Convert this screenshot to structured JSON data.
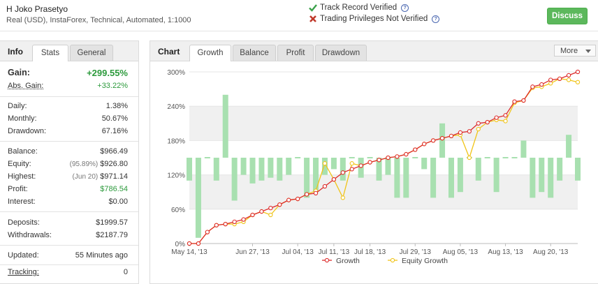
{
  "header": {
    "account_name": "H Joko Prasetyo",
    "account_details": "Real (USD), InstaForex, Technical, Automated, 1:1000",
    "track_record": "Track Record Verified",
    "trading_privileges": "Trading Privileges Not Verified",
    "discuss_label": "Discuss",
    "help_glyph": "?"
  },
  "info": {
    "title": "Info",
    "tabs": [
      {
        "label": "Stats",
        "active": true
      },
      {
        "label": "General",
        "active": false
      }
    ],
    "gain_label": "Gain:",
    "gain_value": "+299.55%",
    "abs_gain_label": "Abs. Gain:",
    "abs_gain_value": "+33.22%",
    "daily_label": "Daily:",
    "daily_value": "1.38%",
    "monthly_label": "Monthly:",
    "monthly_value": "50.67%",
    "drawdown_label": "Drawdown:",
    "drawdown_value": "67.16%",
    "balance_label": "Balance:",
    "balance_value": "$966.49",
    "equity_label": "Equity:",
    "equity_note": "(95.89%)",
    "equity_value": "$926.80",
    "highest_label": "Highest:",
    "highest_note": "(Jun 20)",
    "highest_value": "$971.14",
    "profit_label": "Profit:",
    "profit_value": "$786.54",
    "interest_label": "Interest:",
    "interest_value": "$0.00",
    "deposits_label": "Deposits:",
    "deposits_value": "$1999.57",
    "withdrawals_label": "Withdrawals:",
    "withdrawals_value": "$2187.79",
    "updated_label": "Updated:",
    "updated_value": "55 Minutes ago",
    "tracking_label": "Tracking:",
    "tracking_value": "0"
  },
  "chart_panel": {
    "title": "Chart",
    "tabs": [
      {
        "label": "Growth",
        "active": true
      },
      {
        "label": "Balance",
        "active": false
      },
      {
        "label": "Profit",
        "active": false
      },
      {
        "label": "Drawdown",
        "active": false
      }
    ],
    "more_label": "More"
  },
  "colors": {
    "growth": "#dd2a2a",
    "equity": "#f0c419",
    "bars": "#a8e0b0",
    "gain": "#2c9a3c",
    "verified": "#3aa14a",
    "not_verified": "#c0392b",
    "discuss": "#5cb85c"
  },
  "chart_data": {
    "type": "line",
    "title": "",
    "xlabel": "",
    "ylabel": "",
    "ylim": [
      0,
      300
    ],
    "y_ticks": [
      "0%",
      "60%",
      "120%",
      "180%",
      "240%",
      "300%"
    ],
    "y_tick_values": [
      0,
      60,
      120,
      180,
      240,
      300
    ],
    "x_tick_labels": [
      "May 14, '13",
      "Jun 27, '13",
      "Jul 04, '13",
      "Jul 11, '13",
      "Jul 18, '13",
      "Jul 29, '13",
      "Aug 05, '13",
      "Aug 13, '13",
      "Aug 20, '13"
    ],
    "x_tick_index": [
      0,
      7,
      12,
      16,
      20,
      25,
      30,
      35,
      40
    ],
    "legend_placement": "bottom",
    "series": [
      {
        "name": "Growth",
        "values": [
          0,
          0,
          20,
          32,
          34,
          38,
          42,
          50,
          56,
          62,
          68,
          76,
          78,
          86,
          88,
          100,
          112,
          124,
          130,
          136,
          142,
          146,
          150,
          152,
          156,
          164,
          174,
          180,
          184,
          188,
          194,
          196,
          210,
          212,
          220,
          224,
          248,
          250,
          274,
          278,
          286,
          288,
          294,
          300
        ]
      },
      {
        "name": "Equity Growth",
        "values": [
          0,
          0,
          20,
          32,
          34,
          34,
          38,
          50,
          56,
          50,
          68,
          76,
          78,
          86,
          92,
          140,
          112,
          80,
          140,
          136,
          142,
          146,
          150,
          152,
          156,
          164,
          174,
          180,
          184,
          188,
          190,
          150,
          200,
          212,
          216,
          214,
          246,
          250,
          272,
          274,
          280,
          288,
          286,
          282
        ]
      }
    ],
    "bars": {
      "name": "",
      "baseline": 150,
      "values": [
        -40,
        -140,
        0,
        -40,
        110,
        -75,
        -30,
        -45,
        -40,
        -35,
        -40,
        -30,
        0,
        -70,
        -60,
        -30,
        -20,
        -40,
        0,
        -35,
        0,
        -40,
        -30,
        -70,
        -70,
        0,
        -20,
        -70,
        60,
        -70,
        -60,
        0,
        -40,
        0,
        -60,
        0,
        0,
        30,
        -70,
        -60,
        -70,
        -40,
        40,
        -40
      ],
      "extra_heights": [
        0,
        0,
        0,
        0,
        0,
        0,
        0,
        0,
        0,
        0,
        0,
        0,
        0,
        0,
        0,
        0,
        0,
        0,
        0,
        0,
        0,
        0,
        0,
        0,
        0,
        0,
        0,
        0,
        0,
        0,
        0,
        0,
        0,
        0,
        0,
        0,
        0,
        0,
        0,
        0,
        0,
        0,
        0,
        0
      ]
    }
  }
}
